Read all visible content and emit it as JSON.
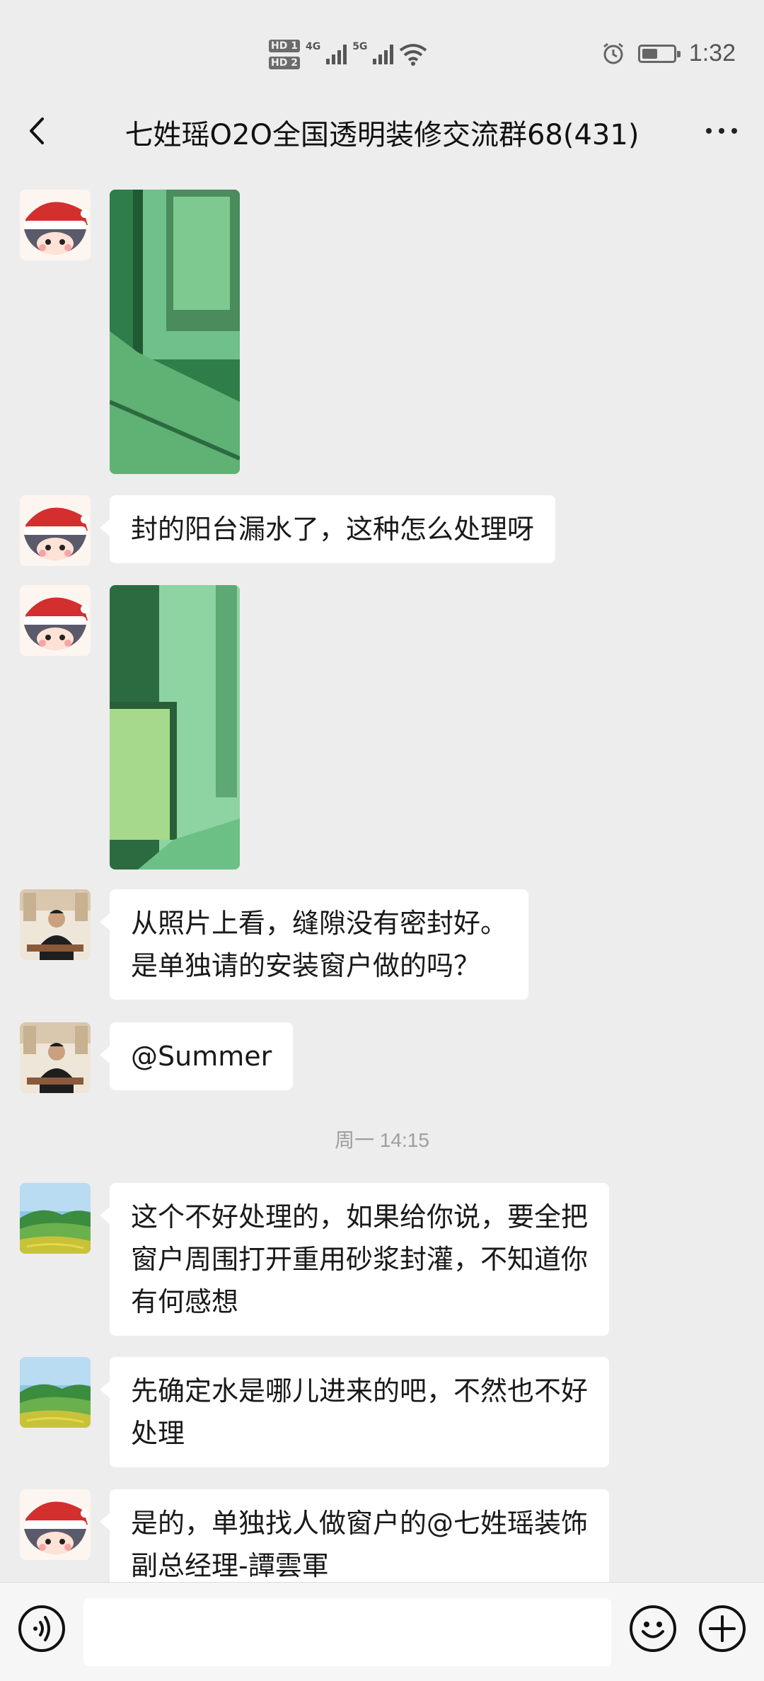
{
  "status_bar": {
    "hd1": "HD 1",
    "hd2": "HD 2",
    "net1": "4G",
    "net2": "5G",
    "time": "1:32",
    "battery_level": 0.5
  },
  "nav": {
    "title": "七姓瑶O2O全国透明装修交流群68(431)"
  },
  "messages": [
    {
      "type": "image",
      "sender": "summer",
      "image": "green-balcony-window-photo"
    },
    {
      "type": "text",
      "sender": "summer",
      "text": "封的阳台漏水了，这种怎么处理呀"
    },
    {
      "type": "image",
      "sender": "summer",
      "image": "green-window-corner-photo"
    },
    {
      "type": "text",
      "sender": "manager",
      "lines": [
        "从照片上看，缝隙没有密封好。",
        "是单独请的安装窗户做的吗？"
      ]
    },
    {
      "type": "text",
      "sender": "manager",
      "text": "@Summer"
    },
    {
      "type": "timestamp",
      "text": "周一 14:15"
    },
    {
      "type": "text",
      "sender": "landscape",
      "lines": [
        "这个不好处理的，如果给你说，要全把",
        "窗户周围打开重用砂浆封灌，不知道你",
        "有何感想"
      ]
    },
    {
      "type": "text",
      "sender": "landscape",
      "lines": [
        "先确定水是哪儿进来的吧，不然也不好",
        "处理"
      ]
    },
    {
      "type": "text",
      "sender": "summer",
      "lines": [
        "是的，单独找人做窗户的@七姓瑶装饰",
        "副总经理-譚雲軍"
      ]
    }
  ],
  "input": {
    "placeholder": "",
    "value": ""
  },
  "icons": {
    "back": "chevron-left-icon",
    "more": "more-dots-icon",
    "voice": "voice-icon",
    "emoji": "emoji-icon",
    "plus": "plus-icon"
  }
}
